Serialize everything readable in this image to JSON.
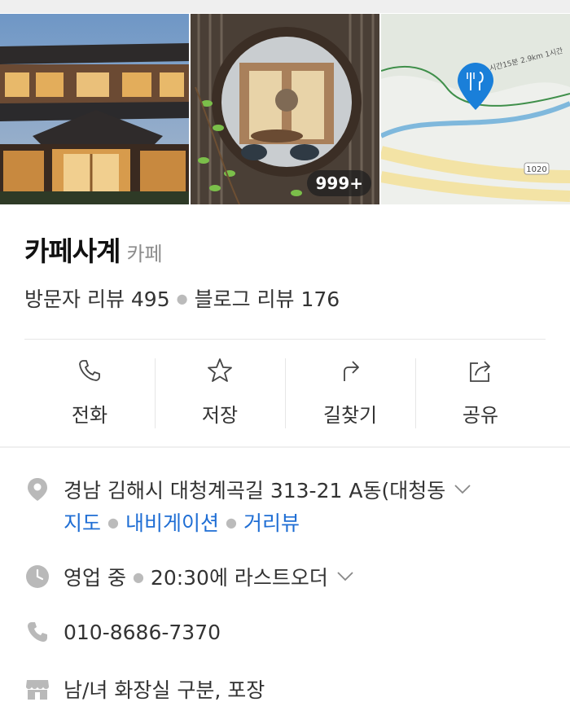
{
  "photos": {
    "count_badge": "999+"
  },
  "place": {
    "name": "카페사계",
    "category": "카페",
    "visitor_reviews": "방문자 리뷰 495",
    "blog_reviews": "블로그 리뷰 176"
  },
  "actions": [
    {
      "label": "전화",
      "icon": "phone-icon"
    },
    {
      "label": "저장",
      "icon": "star-icon"
    },
    {
      "label": "길찾기",
      "icon": "directions-icon"
    },
    {
      "label": "공유",
      "icon": "share-icon"
    }
  ],
  "info": {
    "address": "경남 김해시 대청계곡길 313-21 A동(대청동",
    "links": [
      "지도",
      "내비게이션",
      "거리뷰"
    ],
    "status": "영업 중",
    "last_order": "20:30에 라스트오더",
    "phone": "010-8686-7370",
    "facilities": "남/녀 화장실 구분, 포장"
  },
  "map": {
    "road_number": "1020",
    "road_label": "시간15분 2.9km 1시간"
  },
  "colors": {
    "accent": "#1f6ed4",
    "marker": "#1a7fd9",
    "icon_gray": "#b9b9b9"
  }
}
